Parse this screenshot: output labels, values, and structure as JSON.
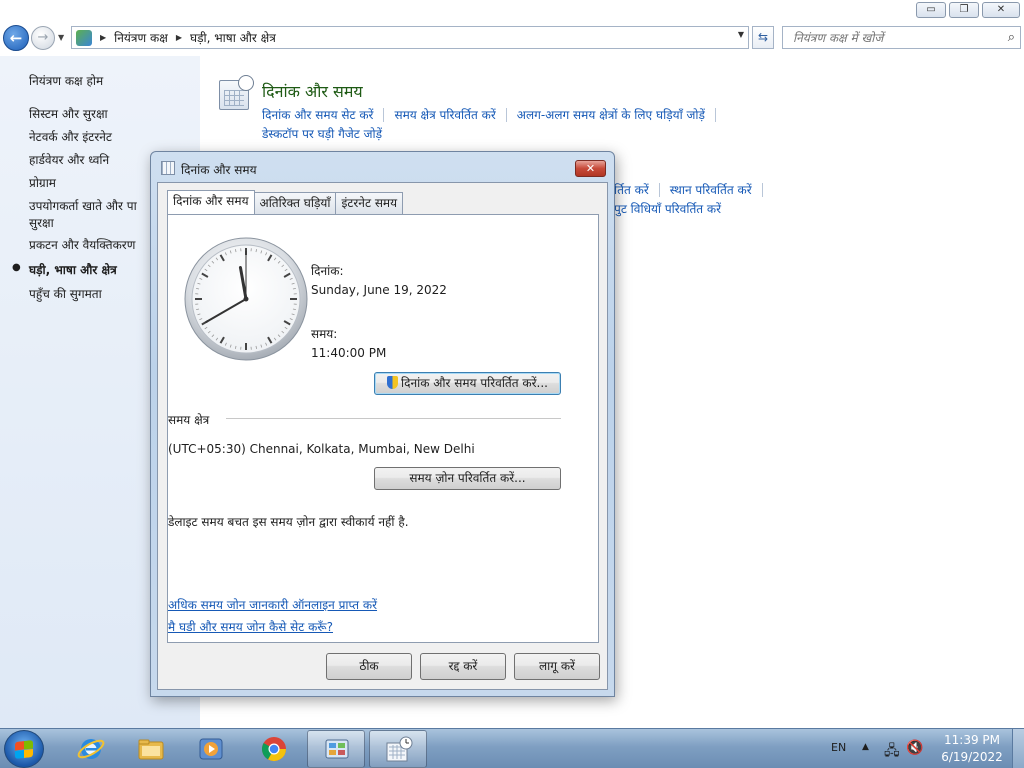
{
  "window": {
    "caption": {
      "minimize": "▭",
      "restore": "❐",
      "close": "✕"
    },
    "nav": {
      "back_icon": "arrow-left",
      "forward_icon": "arrow-right",
      "breadcrumbs": [
        "नियंत्रण कक्ष",
        "घड़ी, भाषा और क्षेत्र"
      ],
      "search_placeholder": "नियंत्रण कक्ष में खोजें"
    }
  },
  "sidebar": {
    "home": "नियंत्रण कक्ष होम",
    "items": [
      "सिस्टम और सुरक्षा",
      "नेटवर्क और इंटरनेट",
      "हार्डवेयर और ध्वनि",
      "प्रोग्राम",
      "उपयोगकर्ता खाते और पा",
      "सुरक्षा",
      "प्रकटन और वैयक्तिकरण",
      "घड़ी, भाषा और क्षेत्र",
      "पहुँच की सुगमता"
    ],
    "active_index": 7
  },
  "main": {
    "category_title": "दिनांक और समय",
    "links_row1": [
      "दिनांक और समय सेट करें",
      "समय क्षेत्र परिवर्तित करें",
      "अलग-अलग समय क्षेत्रों के लिए घड़ियाँ जोड़ें"
    ],
    "links_row2": [
      "डेस्कटॉप पर घड़ी गैजेट जोड़ें"
    ],
    "links_row3": [
      "र्तित करें",
      "स्थान परिवर्तित करें"
    ],
    "links_row4": [
      "पुट विधियाँ परिवर्तित करें"
    ]
  },
  "dialog": {
    "title": "दिनांक और समय",
    "close": "✕",
    "tabs": [
      "दिनांक और समय",
      "अतिरिक्त घड़ियाँ",
      "इंटरनेट समय"
    ],
    "date_label": "दिनांक:",
    "date_value": "Sunday, June 19, 2022",
    "time_label": "समय:",
    "time_value": "11:40:00 PM",
    "clock": {
      "hours": 11,
      "minutes": 40,
      "seconds": 0
    },
    "change_datetime_button": "दिनांक और समय परिवर्तित करें...",
    "timezone_heading": "समय क्षेत्र",
    "timezone_value": "(UTC+05:30) Chennai, Kolkata, Mumbai, New Delhi",
    "change_timezone_button": "समय ज़ोन परिवर्तित करें...",
    "dst_note": "डेलाइट समय बचत इस समय ज़ोन द्वारा स्वीकार्य नहीं है.",
    "link_more_info": "अधिक समय जोन जानकारी ऑनलाइन प्राप्त करें",
    "link_how_to": "मै घडी और समय जोन कैसे सेट करूँ?",
    "ok_button": "ठीक",
    "cancel_button": "रद्द करें",
    "apply_button": "लागू करें"
  },
  "taskbar": {
    "language": "EN",
    "time": "11:39 PM",
    "date": "6/19/2022"
  }
}
